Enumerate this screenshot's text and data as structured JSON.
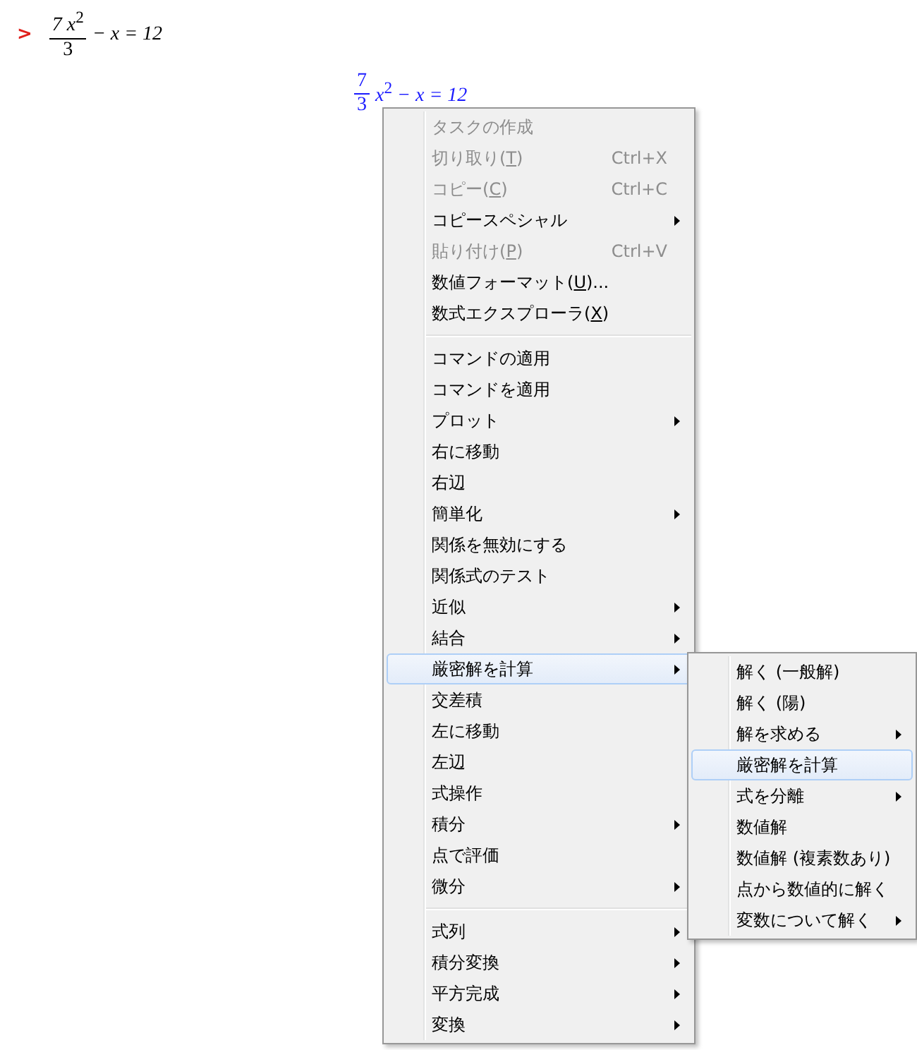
{
  "input": {
    "prompt": ">",
    "numerator": "7 x",
    "exponent": "2",
    "denominator": "3",
    "rest": "− x = 12"
  },
  "output": {
    "numerator": "7",
    "denominator": "3",
    "variable": "x",
    "exponent": "2",
    "rest": "− x = 12"
  },
  "context_menu": {
    "items": [
      {
        "kind": "item",
        "label": "タスクの作成",
        "disabled": true,
        "submenu": false,
        "selected": false
      },
      {
        "kind": "item",
        "label": "切り取り(",
        "mnemonic": "T",
        "label_end": ")",
        "shortcut": "Ctrl+X",
        "disabled": true,
        "submenu": false,
        "selected": false
      },
      {
        "kind": "item",
        "label": "コピー(",
        "mnemonic": "C",
        "label_end": ")",
        "shortcut": "Ctrl+C",
        "disabled": true,
        "submenu": false,
        "selected": false
      },
      {
        "kind": "item",
        "label": "コピースペシャル",
        "disabled": false,
        "submenu": true,
        "selected": false
      },
      {
        "kind": "item",
        "label": "貼り付け(",
        "mnemonic": "P",
        "label_end": ")",
        "shortcut": "Ctrl+V",
        "disabled": true,
        "submenu": false,
        "selected": false
      },
      {
        "kind": "item",
        "label": "数値フォーマット(",
        "mnemonic": "U",
        "label_end": ")...",
        "disabled": false,
        "submenu": false,
        "selected": false
      },
      {
        "kind": "item",
        "label": "数式エクスプローラ(",
        "mnemonic": "X",
        "label_end": ")",
        "disabled": false,
        "submenu": false,
        "selected": false
      },
      {
        "kind": "separator"
      },
      {
        "kind": "item",
        "label": "コマンドの適用",
        "disabled": false,
        "submenu": false,
        "selected": false
      },
      {
        "kind": "item",
        "label": "コマンドを適用",
        "disabled": false,
        "submenu": false,
        "selected": false
      },
      {
        "kind": "item",
        "label": "プロット",
        "disabled": false,
        "submenu": true,
        "selected": false
      },
      {
        "kind": "item",
        "label": "右に移動",
        "disabled": false,
        "submenu": false,
        "selected": false
      },
      {
        "kind": "item",
        "label": "右辺",
        "disabled": false,
        "submenu": false,
        "selected": false
      },
      {
        "kind": "item",
        "label": "簡単化",
        "disabled": false,
        "submenu": true,
        "selected": false
      },
      {
        "kind": "item",
        "label": "関係を無効にする",
        "disabled": false,
        "submenu": false,
        "selected": false
      },
      {
        "kind": "item",
        "label": "関係式のテスト",
        "disabled": false,
        "submenu": false,
        "selected": false
      },
      {
        "kind": "item",
        "label": "近似",
        "disabled": false,
        "submenu": true,
        "selected": false
      },
      {
        "kind": "item",
        "label": "結合",
        "disabled": false,
        "submenu": true,
        "selected": false
      },
      {
        "kind": "item",
        "label": "厳密解を計算",
        "disabled": false,
        "submenu": true,
        "selected": true
      },
      {
        "kind": "item",
        "label": "交差積",
        "disabled": false,
        "submenu": false,
        "selected": false
      },
      {
        "kind": "item",
        "label": "左に移動",
        "disabled": false,
        "submenu": false,
        "selected": false
      },
      {
        "kind": "item",
        "label": "左辺",
        "disabled": false,
        "submenu": false,
        "selected": false
      },
      {
        "kind": "item",
        "label": "式操作",
        "disabled": false,
        "submenu": false,
        "selected": false
      },
      {
        "kind": "item",
        "label": "積分",
        "disabled": false,
        "submenu": true,
        "selected": false
      },
      {
        "kind": "item",
        "label": "点で評価",
        "disabled": false,
        "submenu": false,
        "selected": false
      },
      {
        "kind": "item",
        "label": "微分",
        "disabled": false,
        "submenu": true,
        "selected": false
      },
      {
        "kind": "separator"
      },
      {
        "kind": "item",
        "label": "式列",
        "disabled": false,
        "submenu": true,
        "selected": false
      },
      {
        "kind": "item",
        "label": "積分変換",
        "disabled": false,
        "submenu": true,
        "selected": false
      },
      {
        "kind": "item",
        "label": "平方完成",
        "disabled": false,
        "submenu": true,
        "selected": false
      },
      {
        "kind": "item",
        "label": "変換",
        "disabled": false,
        "submenu": true,
        "selected": false
      }
    ]
  },
  "submenu": {
    "items": [
      {
        "kind": "item",
        "label": "解く (一般解)",
        "disabled": false,
        "submenu": false,
        "selected": false
      },
      {
        "kind": "item",
        "label": "解く (陽)",
        "disabled": false,
        "submenu": false,
        "selected": false
      },
      {
        "kind": "item",
        "label": "解を求める",
        "disabled": false,
        "submenu": true,
        "selected": false
      },
      {
        "kind": "item",
        "label": "厳密解を計算",
        "disabled": false,
        "submenu": false,
        "selected": true
      },
      {
        "kind": "item",
        "label": "式を分離",
        "disabled": false,
        "submenu": true,
        "selected": false
      },
      {
        "kind": "item",
        "label": "数値解",
        "disabled": false,
        "submenu": false,
        "selected": false
      },
      {
        "kind": "item",
        "label": "数値解 (複素数あり)",
        "disabled": false,
        "submenu": false,
        "selected": false
      },
      {
        "kind": "item",
        "label": "点から数値的に解く",
        "disabled": false,
        "submenu": false,
        "selected": false
      },
      {
        "kind": "item",
        "label": "変数について解く",
        "disabled": false,
        "submenu": true,
        "selected": false
      }
    ]
  }
}
